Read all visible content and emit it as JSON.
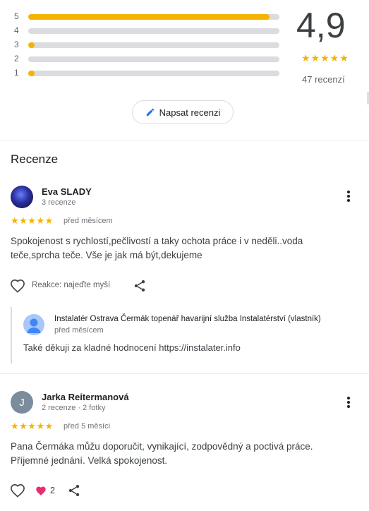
{
  "rating": {
    "histogram": [
      {
        "label": "5",
        "fraction": 0.96
      },
      {
        "label": "4",
        "fraction": 0.0
      },
      {
        "label": "3",
        "fraction": 0.02
      },
      {
        "label": "2",
        "fraction": 0.0
      },
      {
        "label": "1",
        "fraction": 0.02
      }
    ],
    "average": "4,9",
    "stars": "★★★★★",
    "total": "47 recenzí"
  },
  "write_review_label": "Napsat recenzi",
  "section_title": "Recenze",
  "reviews": [
    {
      "author": "Eva SLADY",
      "meta": "3 recenze",
      "stars": "★★★★★",
      "date": "před měsícem",
      "text": "Spokojenost s rychlostí,pečlivostí a taky ochota práce i v neděli..voda teče,sprcha teče. Vše je jak má být,dekujeme",
      "reaction_hint": "Reakce: najeďte myší",
      "owner_reply": {
        "name": "Instalatér Ostrava Čermák topenář havarijní služba Instalatérství (vlastník)",
        "date": "před měsícem",
        "text": "Také děkuji za kladné hodnocení https://instalater.info"
      }
    },
    {
      "author": "Jarka Reitermanová",
      "avatar_letter": "J",
      "meta": "2 recenze · 2 fotky",
      "stars": "★★★★★",
      "date": "před 5 měsíci",
      "text": "Pana Čermáka můžu doporučit, vynikající, zodpovědný a poctivá práce. Příjemné jednání. Velká spokojenost.",
      "reaction_count": "2"
    }
  ],
  "colors": {
    "star": "#f4b400",
    "bar_track": "#dadce0",
    "heart_reaction": "#e52e71",
    "avatar_j": "#7b8d9c"
  }
}
